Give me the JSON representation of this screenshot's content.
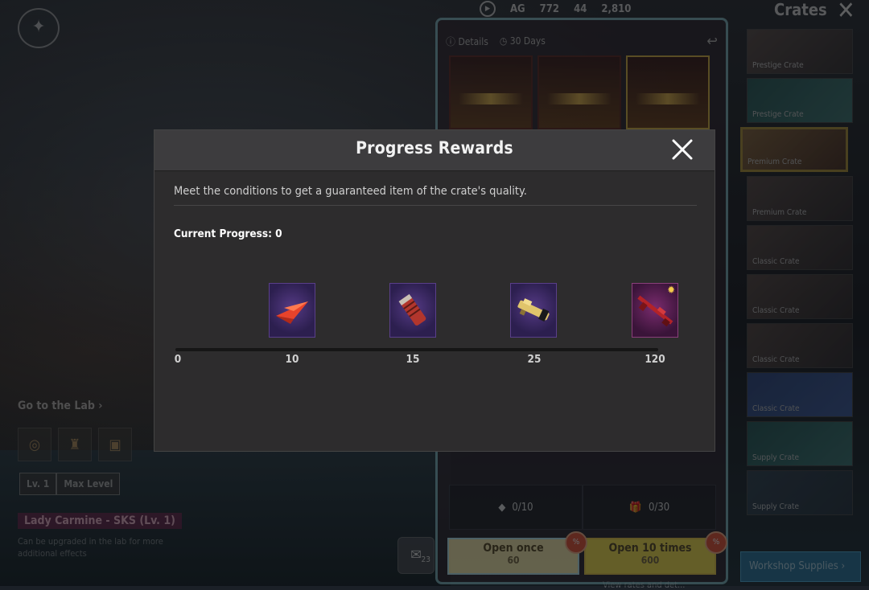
{
  "modal": {
    "title": "Progress Rewards",
    "description": "Meet the conditions to get a guaranteed item of the crate's quality.",
    "current_progress_label": "Current Progress: 0",
    "progress_value": 0,
    "milestones": [
      {
        "value": "10",
        "icon": "red-paper-plane-icon"
      },
      {
        "value": "15",
        "icon": "red-canister-icon"
      },
      {
        "value": "25",
        "icon": "gold-gun-attachment-icon"
      },
      {
        "value": "120",
        "icon": "red-rifle-skin-icon",
        "upgradeable": true
      }
    ],
    "start_label": "0"
  },
  "currency": {
    "ag": "AG",
    "bp": "772",
    "uc": "44",
    "coupon": "2,810"
  },
  "crates_panel": {
    "title": "Crates",
    "items": [
      "Prestige Crate",
      "Prestige Crate",
      "Premium Crate",
      "Premium Crate",
      "Classic Crate",
      "Classic Crate",
      "Classic Crate",
      "Classic Crate",
      "Supply Crate",
      "Supply Crate"
    ],
    "workshop_label": "Workshop Supplies"
  },
  "crate_info": {
    "details": "Details",
    "days": "30 Days",
    "stat1": "0/10",
    "stat2": "0/30",
    "open_once": "Open once",
    "open_once_price": "60",
    "open_ten": "Open 10 times",
    "open_ten_price": "600",
    "view_rates": "View rates and det..."
  },
  "left_panel": {
    "lab_link": "Go to the Lab",
    "level_current": "Lv. 1",
    "level_max": "Max Level",
    "item_name": "Lady Carmine - SKS (Lv. 1)",
    "item_desc": "Can be upgraded in the lab for more additional effects",
    "ticket_count": "23"
  }
}
